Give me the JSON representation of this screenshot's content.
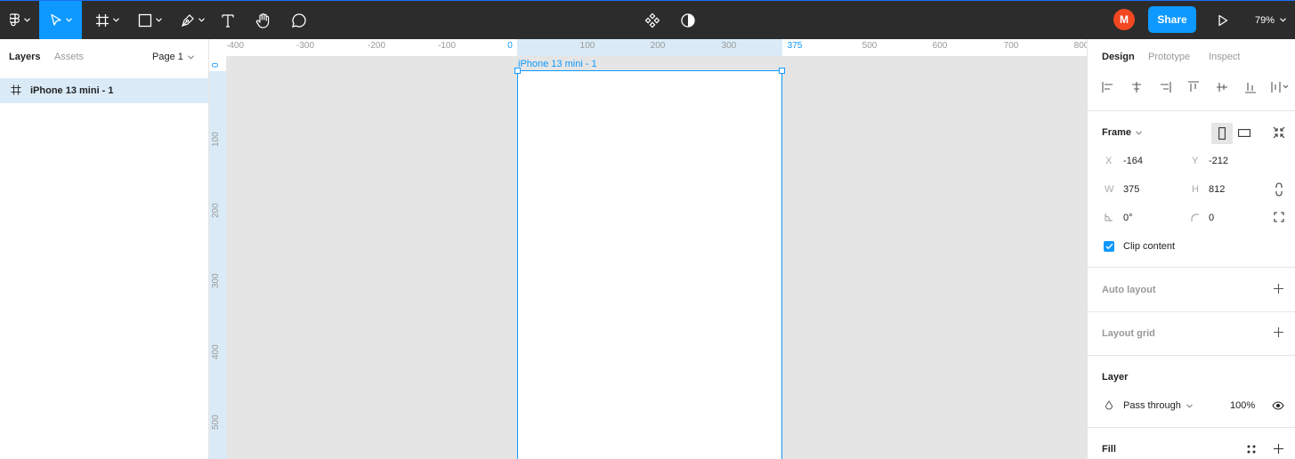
{
  "toolbar": {
    "menu_icon": "figma-logo-icon",
    "tools": [
      "move-tool",
      "frame-tool",
      "shape-tool",
      "pen-tool",
      "text-tool",
      "hand-tool",
      "comment-tool"
    ],
    "center_icons": [
      "components-icon",
      "contrast-icon"
    ],
    "avatar_initial": "M",
    "share_label": "Share",
    "play_icon": "present-icon",
    "zoom_level": "79%",
    "accent": "#0d99ff",
    "avatar_color": "#f24822"
  },
  "left_panel": {
    "tab_layers": "Layers",
    "tab_assets": "Assets",
    "page_selector": "Page 1",
    "layers": [
      {
        "name": "iPhone 13 mini - 1",
        "type": "frame"
      }
    ]
  },
  "ruler_top": {
    "labels": [
      "-400",
      "-300",
      "-200",
      "-100",
      "0",
      "100",
      "200",
      "300",
      "375",
      "500",
      "600",
      "700",
      "800"
    ],
    "highlight_start": "0",
    "highlight_end": "375"
  },
  "ruler_left": {
    "labels": [
      "0",
      "100",
      "200",
      "300",
      "400",
      "500"
    ]
  },
  "canvas": {
    "frame_label": "iPhone 13 mini - 1"
  },
  "right_panel": {
    "tab_design": "Design",
    "tab_prototype": "Prototype",
    "tab_inspect": "Inspect",
    "frame_section": "Frame",
    "x_label": "X",
    "x_value": "-164",
    "y_label": "Y",
    "y_value": "-212",
    "w_label": "W",
    "w_value": "375",
    "h_label": "H",
    "h_value": "812",
    "rotation_value": "0°",
    "radius_value": "0",
    "clip_content_label": "Clip content",
    "clip_content_checked": true,
    "auto_layout_section": "Auto layout",
    "layout_grid_section": "Layout grid",
    "layer_section": "Layer",
    "blend_mode": "Pass through",
    "opacity": "100%",
    "fill_section": "Fill"
  }
}
